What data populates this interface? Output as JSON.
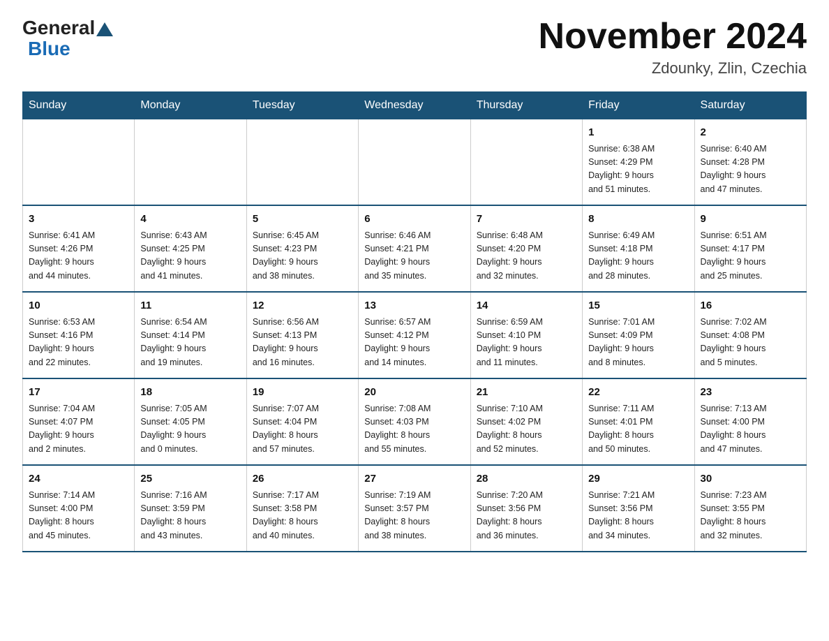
{
  "header": {
    "logo_general": "General",
    "logo_blue": "Blue",
    "month_year": "November 2024",
    "location": "Zdounky, Zlin, Czechia"
  },
  "weekdays": [
    "Sunday",
    "Monday",
    "Tuesday",
    "Wednesday",
    "Thursday",
    "Friday",
    "Saturday"
  ],
  "weeks": [
    [
      {
        "day": "",
        "info": "",
        "empty": true
      },
      {
        "day": "",
        "info": "",
        "empty": true
      },
      {
        "day": "",
        "info": "",
        "empty": true
      },
      {
        "day": "",
        "info": "",
        "empty": true
      },
      {
        "day": "",
        "info": "",
        "empty": true
      },
      {
        "day": "1",
        "info": "Sunrise: 6:38 AM\nSunset: 4:29 PM\nDaylight: 9 hours\nand 51 minutes."
      },
      {
        "day": "2",
        "info": "Sunrise: 6:40 AM\nSunset: 4:28 PM\nDaylight: 9 hours\nand 47 minutes."
      }
    ],
    [
      {
        "day": "3",
        "info": "Sunrise: 6:41 AM\nSunset: 4:26 PM\nDaylight: 9 hours\nand 44 minutes."
      },
      {
        "day": "4",
        "info": "Sunrise: 6:43 AM\nSunset: 4:25 PM\nDaylight: 9 hours\nand 41 minutes."
      },
      {
        "day": "5",
        "info": "Sunrise: 6:45 AM\nSunset: 4:23 PM\nDaylight: 9 hours\nand 38 minutes."
      },
      {
        "day": "6",
        "info": "Sunrise: 6:46 AM\nSunset: 4:21 PM\nDaylight: 9 hours\nand 35 minutes."
      },
      {
        "day": "7",
        "info": "Sunrise: 6:48 AM\nSunset: 4:20 PM\nDaylight: 9 hours\nand 32 minutes."
      },
      {
        "day": "8",
        "info": "Sunrise: 6:49 AM\nSunset: 4:18 PM\nDaylight: 9 hours\nand 28 minutes."
      },
      {
        "day": "9",
        "info": "Sunrise: 6:51 AM\nSunset: 4:17 PM\nDaylight: 9 hours\nand 25 minutes."
      }
    ],
    [
      {
        "day": "10",
        "info": "Sunrise: 6:53 AM\nSunset: 4:16 PM\nDaylight: 9 hours\nand 22 minutes."
      },
      {
        "day": "11",
        "info": "Sunrise: 6:54 AM\nSunset: 4:14 PM\nDaylight: 9 hours\nand 19 minutes."
      },
      {
        "day": "12",
        "info": "Sunrise: 6:56 AM\nSunset: 4:13 PM\nDaylight: 9 hours\nand 16 minutes."
      },
      {
        "day": "13",
        "info": "Sunrise: 6:57 AM\nSunset: 4:12 PM\nDaylight: 9 hours\nand 14 minutes."
      },
      {
        "day": "14",
        "info": "Sunrise: 6:59 AM\nSunset: 4:10 PM\nDaylight: 9 hours\nand 11 minutes."
      },
      {
        "day": "15",
        "info": "Sunrise: 7:01 AM\nSunset: 4:09 PM\nDaylight: 9 hours\nand 8 minutes."
      },
      {
        "day": "16",
        "info": "Sunrise: 7:02 AM\nSunset: 4:08 PM\nDaylight: 9 hours\nand 5 minutes."
      }
    ],
    [
      {
        "day": "17",
        "info": "Sunrise: 7:04 AM\nSunset: 4:07 PM\nDaylight: 9 hours\nand 2 minutes."
      },
      {
        "day": "18",
        "info": "Sunrise: 7:05 AM\nSunset: 4:05 PM\nDaylight: 9 hours\nand 0 minutes."
      },
      {
        "day": "19",
        "info": "Sunrise: 7:07 AM\nSunset: 4:04 PM\nDaylight: 8 hours\nand 57 minutes."
      },
      {
        "day": "20",
        "info": "Sunrise: 7:08 AM\nSunset: 4:03 PM\nDaylight: 8 hours\nand 55 minutes."
      },
      {
        "day": "21",
        "info": "Sunrise: 7:10 AM\nSunset: 4:02 PM\nDaylight: 8 hours\nand 52 minutes."
      },
      {
        "day": "22",
        "info": "Sunrise: 7:11 AM\nSunset: 4:01 PM\nDaylight: 8 hours\nand 50 minutes."
      },
      {
        "day": "23",
        "info": "Sunrise: 7:13 AM\nSunset: 4:00 PM\nDaylight: 8 hours\nand 47 minutes."
      }
    ],
    [
      {
        "day": "24",
        "info": "Sunrise: 7:14 AM\nSunset: 4:00 PM\nDaylight: 8 hours\nand 45 minutes."
      },
      {
        "day": "25",
        "info": "Sunrise: 7:16 AM\nSunset: 3:59 PM\nDaylight: 8 hours\nand 43 minutes."
      },
      {
        "day": "26",
        "info": "Sunrise: 7:17 AM\nSunset: 3:58 PM\nDaylight: 8 hours\nand 40 minutes."
      },
      {
        "day": "27",
        "info": "Sunrise: 7:19 AM\nSunset: 3:57 PM\nDaylight: 8 hours\nand 38 minutes."
      },
      {
        "day": "28",
        "info": "Sunrise: 7:20 AM\nSunset: 3:56 PM\nDaylight: 8 hours\nand 36 minutes."
      },
      {
        "day": "29",
        "info": "Sunrise: 7:21 AM\nSunset: 3:56 PM\nDaylight: 8 hours\nand 34 minutes."
      },
      {
        "day": "30",
        "info": "Sunrise: 7:23 AM\nSunset: 3:55 PM\nDaylight: 8 hours\nand 32 minutes."
      }
    ]
  ]
}
